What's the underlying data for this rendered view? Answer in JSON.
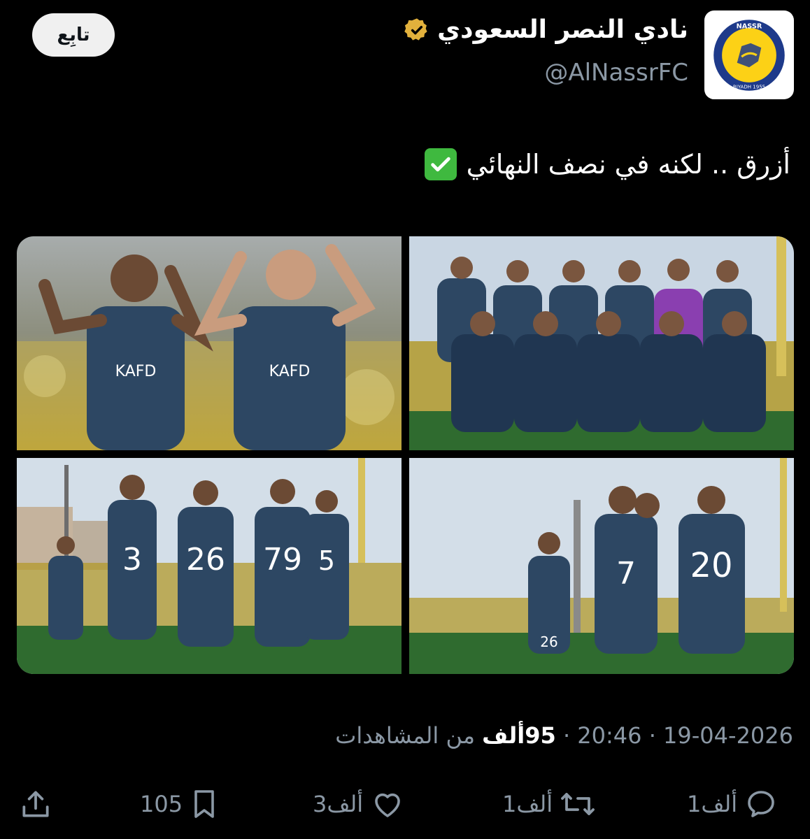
{
  "account": {
    "display_name": "نادي النصر السعودي",
    "handle": "@AlNassrFC",
    "verified_badge_color": "#e2b13c",
    "avatar_colors": {
      "ring": "#1e3a8a",
      "fill": "#fcd116"
    },
    "avatar_text": {
      "top": "NASSR",
      "bottom": "RIYADH 1955"
    }
  },
  "follow_button": {
    "label": "تابِع"
  },
  "tweet": {
    "text": "أزرق .. لكنه في نصف النهائي",
    "emoji_name": "check-mark-button"
  },
  "media": {
    "count": 4,
    "description_colors": {
      "kit": "#2d4763",
      "pitch": "#2f6b2f",
      "sky": "#c9d6e3",
      "stands": "#b39a2c"
    },
    "jersey_texts": {
      "kafd": "KAFD",
      "numbers": [
        "3",
        "26",
        "79",
        "5",
        "7",
        "20",
        "26"
      ]
    }
  },
  "meta": {
    "date": "19-04-2026",
    "time": "20:46",
    "views_count": "95ألف",
    "views_label": "من المشاهدات",
    "separator": "·"
  },
  "actions": {
    "reply_count": "1ألف",
    "retweet_count": "1ألف",
    "like_count": "3ألف",
    "bookmark_count": "105"
  },
  "colors": {
    "background": "#000000",
    "primary_text": "#ffffff",
    "secondary_text": "#8b98a5",
    "follow_bg": "#f0f0f0",
    "check_green": "#3fb93f"
  }
}
